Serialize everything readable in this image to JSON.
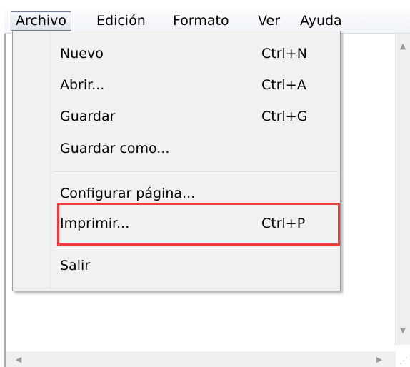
{
  "menubar": {
    "items": [
      {
        "label": "Archivo"
      },
      {
        "label": "Edición"
      },
      {
        "label": "Formato"
      },
      {
        "label": "Ver"
      },
      {
        "label": "Ayuda"
      }
    ],
    "open_item": "Archivo"
  },
  "file_menu": {
    "items": [
      {
        "label": "Nuevo",
        "shortcut": "Ctrl+N"
      },
      {
        "label": "Abrir...",
        "shortcut": "Ctrl+A"
      },
      {
        "label": "Guardar",
        "shortcut": "Ctrl+G"
      },
      {
        "label": "Guardar como...",
        "shortcut": ""
      },
      {
        "label": "Configurar página...",
        "shortcut": ""
      },
      {
        "label": "Imprimir...",
        "shortcut": "Ctrl+P"
      },
      {
        "label": "Salir",
        "shortcut": ""
      }
    ],
    "highlighted_item": "Imprimir..."
  },
  "icons": {
    "scroll_up": "up-arrow-icon",
    "scroll_down": "down-arrow-icon",
    "scroll_left": "left-arrow-icon",
    "scroll_right": "right-arrow-icon",
    "resize": "size-grip-icon"
  },
  "colors": {
    "annotation_outline": "#ef3b3b",
    "menu_background": "#f1f1f1"
  }
}
